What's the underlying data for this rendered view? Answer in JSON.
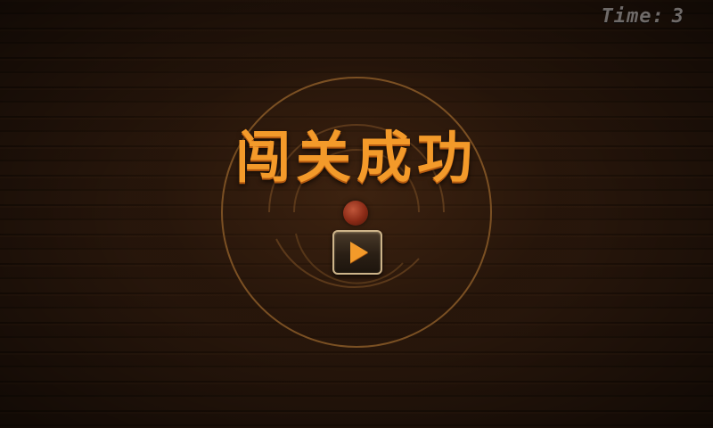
{
  "hud": {
    "timer_label": "Time:",
    "timer_value": "3"
  },
  "result": {
    "title": "闯关成功"
  },
  "controls": {
    "play_icon": "play-icon"
  },
  "colors": {
    "accent": "#f39a2a",
    "ring": "#8a5a28",
    "timer": "#6f6a68",
    "ball": "#8a2a16"
  }
}
